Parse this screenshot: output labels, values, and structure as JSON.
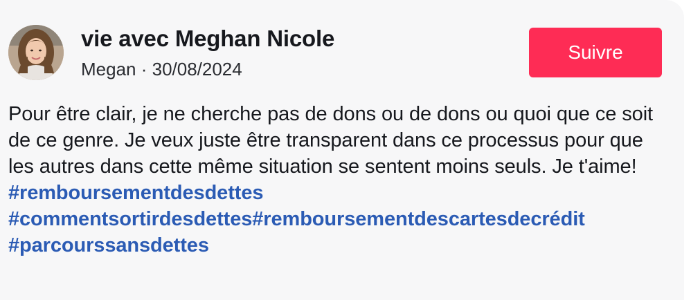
{
  "post": {
    "author_name": "vie avec Meghan Nicole",
    "meta": "Megan · 30/08/2024",
    "follow_label": "Suivre",
    "caption_text": "Pour être clair, je ne cherche pas de dons ou de dons ou quoi que ce soit de ce genre. Je veux juste être transparent dans ce processus pour que les autres dans cette même situation se sentent moins seuls. Je t'aime! ",
    "hashtags": [
      "#remboursementdesdettes",
      "#commentsortirdesdettes",
      "#remboursementdescartesdecrédit",
      "#parcourssansdettes"
    ]
  },
  "colors": {
    "follow_button": "#fe2c55",
    "hashtag": "#2b5bb4",
    "card_background": "#f7f7f8"
  },
  "icons": {
    "avatar": "profile-photo"
  }
}
